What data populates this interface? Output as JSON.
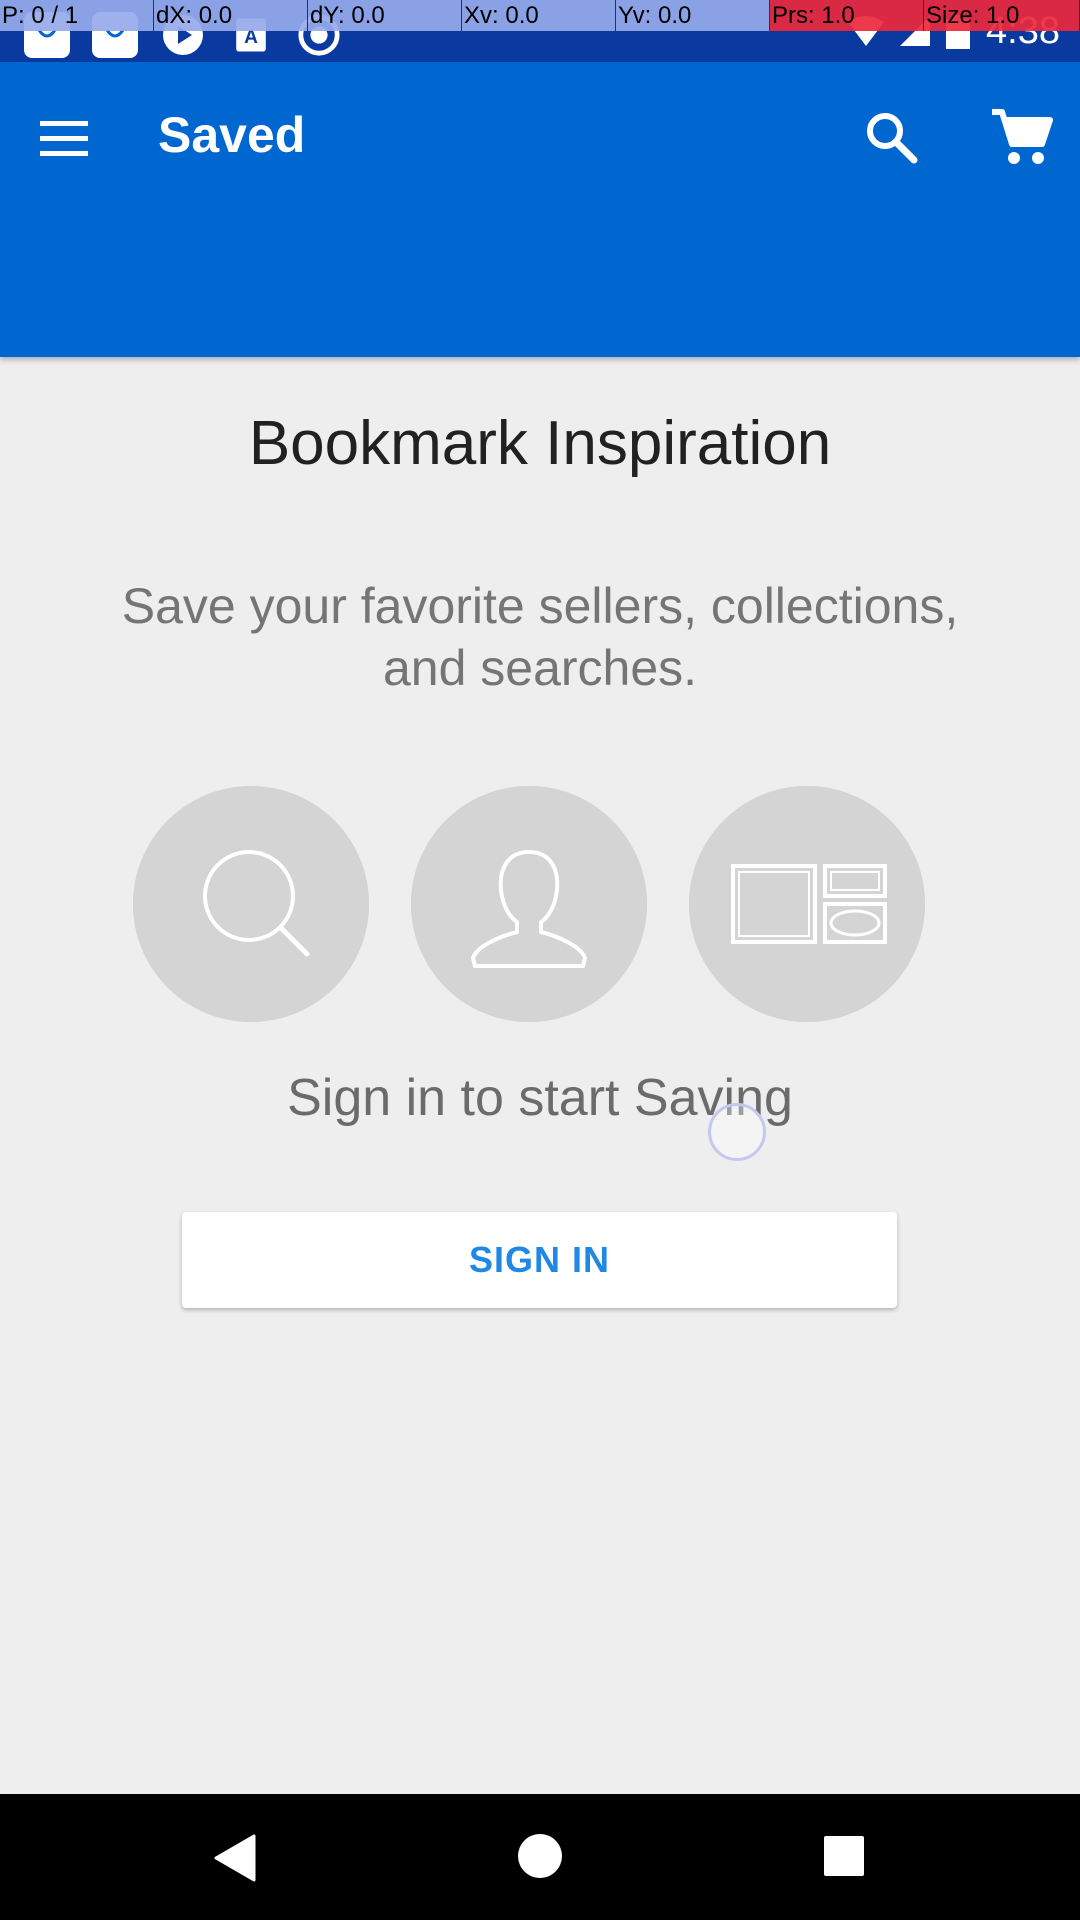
{
  "status_bar": {
    "time": "4:38",
    "notification_icons": [
      "shopping-bag-icon",
      "shopping-bag-icon",
      "play-icon",
      "text-icon",
      "record-icon"
    ],
    "right_icons": [
      "wifi-icon",
      "signal-icon",
      "battery-icon"
    ]
  },
  "debug_overlay": {
    "pointer": "P: 0 / 1",
    "dx": "dX: 0.0",
    "dy": "dY: 0.0",
    "xv": "Xv: 0.0",
    "yv": "Yv: 0.0",
    "prs": "Prs: 1.0",
    "size": "Size: 1.0"
  },
  "app_bar": {
    "title": "Saved",
    "background": "#0066d0",
    "icons": [
      "menu-icon",
      "search-icon",
      "cart-icon"
    ]
  },
  "main": {
    "headline": "Bookmark Inspiration",
    "subtitle": "Save your favorite sellers, collections, and searches.",
    "feature_icons": [
      "search-icon",
      "user-icon",
      "collection-icon"
    ],
    "signin_prompt": "Sign in to start Saving",
    "signin_button_label": "SIGN IN"
  },
  "nav_bar": {
    "icons": [
      "back-icon",
      "home-icon",
      "recents-icon"
    ]
  }
}
